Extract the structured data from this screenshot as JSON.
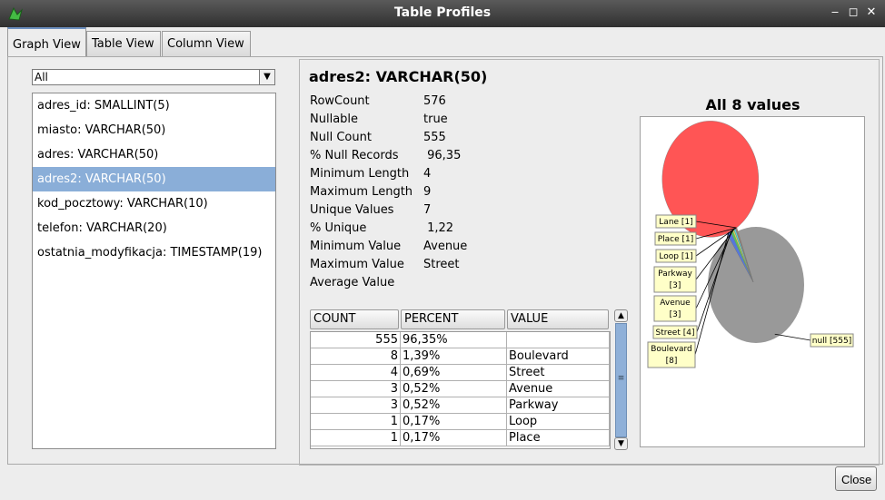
{
  "window": {
    "title": "Table Profiles"
  },
  "tabs": [
    "Graph View",
    "Table View",
    "Column View"
  ],
  "filter": {
    "selected": "All"
  },
  "columns": [
    "adres_id: SMALLINT(5)",
    "miasto: VARCHAR(50)",
    "adres: VARCHAR(50)",
    "adres2: VARCHAR(50)",
    "kod_pocztowy: VARCHAR(10)",
    "telefon: VARCHAR(20)",
    "ostatnia_modyfikacja: TIMESTAMP(19)"
  ],
  "selected_column_index": 3,
  "detail": {
    "heading": "adres2: VARCHAR(50)",
    "stats": [
      {
        "label": "RowCount",
        "value": "576"
      },
      {
        "label": "Nullable",
        "value": "true"
      },
      {
        "label": "Null Count",
        "value": "555"
      },
      {
        "label": "% Null Records",
        "value": " 96,35"
      },
      {
        "label": "Minimum Length",
        "value": "4"
      },
      {
        "label": "Maximum Length",
        "value": "9"
      },
      {
        "label": "Unique Values",
        "value": "7"
      },
      {
        "label": "% Unique",
        "value": " 1,22"
      },
      {
        "label": "Minimum Value",
        "value": "Avenue"
      },
      {
        "label": "Maximum Value",
        "value": "Street"
      },
      {
        "label": "Average Value",
        "value": ""
      }
    ],
    "table": {
      "headers": [
        "COUNT",
        "PERCENT",
        "VALUE"
      ],
      "rows": [
        [
          "555",
          "96,35%",
          ""
        ],
        [
          "8",
          "1,39%",
          "Boulevard"
        ],
        [
          "4",
          "0,69%",
          "Street"
        ],
        [
          "3",
          "0,52%",
          "Avenue"
        ],
        [
          "3",
          "0,52%",
          "Parkway"
        ],
        [
          "1",
          "0,17%",
          "Loop"
        ],
        [
          "1",
          "0,17%",
          "Place"
        ]
      ]
    }
  },
  "chart": {
    "title": "All 8 values",
    "colors": {
      "null": "#ff5555",
      "boulevard": "#5577dd",
      "street": "#55cc55",
      "avenue": "#dddd55",
      "parkway": "#55dddd",
      "loop": "#dd55dd",
      "place": "#aaaaaa",
      "lane": "#ffaa44"
    }
  },
  "chart_data": {
    "type": "pie",
    "title": "All 8 values",
    "slices": [
      {
        "label": "null [555]",
        "value": 555
      },
      {
        "label": "Boulevard [8]",
        "value": 8
      },
      {
        "label": "Street [4]",
        "value": 4
      },
      {
        "label": "Avenue [3]",
        "value": 3
      },
      {
        "label": "Parkway [3]",
        "value": 3
      },
      {
        "label": "Loop [1]",
        "value": 1
      },
      {
        "label": "Place [1]",
        "value": 1
      },
      {
        "label": "Lane [1]",
        "value": 1
      }
    ]
  },
  "buttons": {
    "close": "Close"
  },
  "icons": {
    "minimize": "minimize-icon",
    "maximize": "maximize-icon",
    "close": "close-icon",
    "dropdown": "chevron-down-icon"
  }
}
